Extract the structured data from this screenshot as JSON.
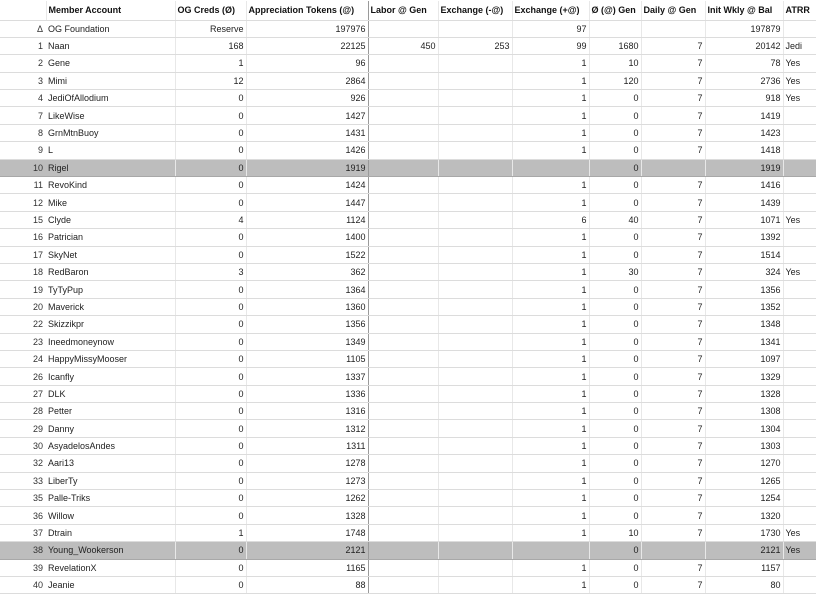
{
  "headers": [
    "",
    "Member Account",
    "OG Creds (Ø)",
    "Appreciation Tokens (@)",
    "Labor @ Gen",
    "Exchange (-@)",
    "Exchange (+@)",
    "Ø (@) Gen",
    "Daily @ Gen",
    "Init Wkly @ Bal",
    "ATRR"
  ],
  "rows": [
    {
      "idx": "Δ",
      "name": "OG Foundation",
      "og": "Reserve",
      "tok": "197976",
      "labor": "",
      "exm": "",
      "exp": "97",
      "gen": "",
      "daily": "",
      "bal": "197879",
      "atrr": "",
      "hl": false
    },
    {
      "idx": "1",
      "name": "Naan",
      "og": "168",
      "tok": "22125",
      "labor": "450",
      "exm": "253",
      "exp": "99",
      "gen": "1680",
      "daily": "7",
      "bal": "20142",
      "atrr": "Jedi",
      "hl": false
    },
    {
      "idx": "2",
      "name": "Gene",
      "og": "1",
      "tok": "96",
      "labor": "",
      "exm": "",
      "exp": "1",
      "gen": "10",
      "daily": "7",
      "bal": "78",
      "atrr": "Yes",
      "hl": false
    },
    {
      "idx": "3",
      "name": "Mimi",
      "og": "12",
      "tok": "2864",
      "labor": "",
      "exm": "",
      "exp": "1",
      "gen": "120",
      "daily": "7",
      "bal": "2736",
      "atrr": "Yes",
      "hl": false
    },
    {
      "idx": "4",
      "name": "JediOfAllodium",
      "og": "0",
      "tok": "926",
      "labor": "",
      "exm": "",
      "exp": "1",
      "gen": "0",
      "daily": "7",
      "bal": "918",
      "atrr": "Yes",
      "hl": false
    },
    {
      "idx": "7",
      "name": "LikeWise",
      "og": "0",
      "tok": "1427",
      "labor": "",
      "exm": "",
      "exp": "1",
      "gen": "0",
      "daily": "7",
      "bal": "1419",
      "atrr": "",
      "hl": false
    },
    {
      "idx": "8",
      "name": "GrnMtnBuoy",
      "og": "0",
      "tok": "1431",
      "labor": "",
      "exm": "",
      "exp": "1",
      "gen": "0",
      "daily": "7",
      "bal": "1423",
      "atrr": "",
      "hl": false
    },
    {
      "idx": "9",
      "name": "L",
      "og": "0",
      "tok": "1426",
      "labor": "",
      "exm": "",
      "exp": "1",
      "gen": "0",
      "daily": "7",
      "bal": "1418",
      "atrr": "",
      "hl": false
    },
    {
      "idx": "10",
      "name": "Rigel",
      "og": "0",
      "tok": "1919",
      "labor": "",
      "exm": "",
      "exp": "",
      "gen": "0",
      "daily": "",
      "bal": "1919",
      "atrr": "",
      "hl": true
    },
    {
      "idx": "11",
      "name": "RevoKind",
      "og": "0",
      "tok": "1424",
      "labor": "",
      "exm": "",
      "exp": "1",
      "gen": "0",
      "daily": "7",
      "bal": "1416",
      "atrr": "",
      "hl": false
    },
    {
      "idx": "12",
      "name": "Mike",
      "og": "0",
      "tok": "1447",
      "labor": "",
      "exm": "",
      "exp": "1",
      "gen": "0",
      "daily": "7",
      "bal": "1439",
      "atrr": "",
      "hl": false
    },
    {
      "idx": "15",
      "name": "Clyde",
      "og": "4",
      "tok": "1124",
      "labor": "",
      "exm": "",
      "exp": "6",
      "gen": "40",
      "daily": "7",
      "bal": "1071",
      "atrr": "Yes",
      "hl": false
    },
    {
      "idx": "16",
      "name": "Patrician",
      "og": "0",
      "tok": "1400",
      "labor": "",
      "exm": "",
      "exp": "1",
      "gen": "0",
      "daily": "7",
      "bal": "1392",
      "atrr": "",
      "hl": false
    },
    {
      "idx": "17",
      "name": "SkyNet",
      "og": "0",
      "tok": "1522",
      "labor": "",
      "exm": "",
      "exp": "1",
      "gen": "0",
      "daily": "7",
      "bal": "1514",
      "atrr": "",
      "hl": false
    },
    {
      "idx": "18",
      "name": "RedBaron",
      "og": "3",
      "tok": "362",
      "labor": "",
      "exm": "",
      "exp": "1",
      "gen": "30",
      "daily": "7",
      "bal": "324",
      "atrr": "Yes",
      "hl": false
    },
    {
      "idx": "19",
      "name": "TyTyPup",
      "og": "0",
      "tok": "1364",
      "labor": "",
      "exm": "",
      "exp": "1",
      "gen": "0",
      "daily": "7",
      "bal": "1356",
      "atrr": "",
      "hl": false
    },
    {
      "idx": "20",
      "name": "Maverick",
      "og": "0",
      "tok": "1360",
      "labor": "",
      "exm": "",
      "exp": "1",
      "gen": "0",
      "daily": "7",
      "bal": "1352",
      "atrr": "",
      "hl": false
    },
    {
      "idx": "22",
      "name": "Skizzikpr",
      "og": "0",
      "tok": "1356",
      "labor": "",
      "exm": "",
      "exp": "1",
      "gen": "0",
      "daily": "7",
      "bal": "1348",
      "atrr": "",
      "hl": false
    },
    {
      "idx": "23",
      "name": "Ineedmoneynow",
      "og": "0",
      "tok": "1349",
      "labor": "",
      "exm": "",
      "exp": "1",
      "gen": "0",
      "daily": "7",
      "bal": "1341",
      "atrr": "",
      "hl": false
    },
    {
      "idx": "24",
      "name": "HappyMissyMooser",
      "og": "0",
      "tok": "1105",
      "labor": "",
      "exm": "",
      "exp": "1",
      "gen": "0",
      "daily": "7",
      "bal": "1097",
      "atrr": "",
      "hl": false
    },
    {
      "idx": "26",
      "name": "Icanfly",
      "og": "0",
      "tok": "1337",
      "labor": "",
      "exm": "",
      "exp": "1",
      "gen": "0",
      "daily": "7",
      "bal": "1329",
      "atrr": "",
      "hl": false
    },
    {
      "idx": "27",
      "name": "DLK",
      "og": "0",
      "tok": "1336",
      "labor": "",
      "exm": "",
      "exp": "1",
      "gen": "0",
      "daily": "7",
      "bal": "1328",
      "atrr": "",
      "hl": false
    },
    {
      "idx": "28",
      "name": "Petter",
      "og": "0",
      "tok": "1316",
      "labor": "",
      "exm": "",
      "exp": "1",
      "gen": "0",
      "daily": "7",
      "bal": "1308",
      "atrr": "",
      "hl": false
    },
    {
      "idx": "29",
      "name": "Danny",
      "og": "0",
      "tok": "1312",
      "labor": "",
      "exm": "",
      "exp": "1",
      "gen": "0",
      "daily": "7",
      "bal": "1304",
      "atrr": "",
      "hl": false
    },
    {
      "idx": "30",
      "name": "AsyadelosAndes",
      "og": "0",
      "tok": "1311",
      "labor": "",
      "exm": "",
      "exp": "1",
      "gen": "0",
      "daily": "7",
      "bal": "1303",
      "atrr": "",
      "hl": false
    },
    {
      "idx": "32",
      "name": "Aari13",
      "og": "0",
      "tok": "1278",
      "labor": "",
      "exm": "",
      "exp": "1",
      "gen": "0",
      "daily": "7",
      "bal": "1270",
      "atrr": "",
      "hl": false
    },
    {
      "idx": "33",
      "name": "LiberTy",
      "og": "0",
      "tok": "1273",
      "labor": "",
      "exm": "",
      "exp": "1",
      "gen": "0",
      "daily": "7",
      "bal": "1265",
      "atrr": "",
      "hl": false
    },
    {
      "idx": "35",
      "name": "Palle-Triks",
      "og": "0",
      "tok": "1262",
      "labor": "",
      "exm": "",
      "exp": "1",
      "gen": "0",
      "daily": "7",
      "bal": "1254",
      "atrr": "",
      "hl": false
    },
    {
      "idx": "36",
      "name": "Willow",
      "og": "0",
      "tok": "1328",
      "labor": "",
      "exm": "",
      "exp": "1",
      "gen": "0",
      "daily": "7",
      "bal": "1320",
      "atrr": "",
      "hl": false
    },
    {
      "idx": "37",
      "name": "Dtrain",
      "og": "1",
      "tok": "1748",
      "labor": "",
      "exm": "",
      "exp": "1",
      "gen": "10",
      "daily": "7",
      "bal": "1730",
      "atrr": "Yes",
      "hl": false
    },
    {
      "idx": "38",
      "name": "Young_Wookerson",
      "og": "0",
      "tok": "2121",
      "labor": "",
      "exm": "",
      "exp": "",
      "gen": "0",
      "daily": "",
      "bal": "2121",
      "atrr": "Yes",
      "hl": true
    },
    {
      "idx": "39",
      "name": "RevelationX",
      "og": "0",
      "tok": "1165",
      "labor": "",
      "exm": "",
      "exp": "1",
      "gen": "0",
      "daily": "7",
      "bal": "1157",
      "atrr": "",
      "hl": false
    },
    {
      "idx": "40",
      "name": "Jeanie",
      "og": "0",
      "tok": "88",
      "labor": "",
      "exm": "",
      "exp": "1",
      "gen": "0",
      "daily": "7",
      "bal": "80",
      "atrr": "",
      "hl": false
    }
  ]
}
